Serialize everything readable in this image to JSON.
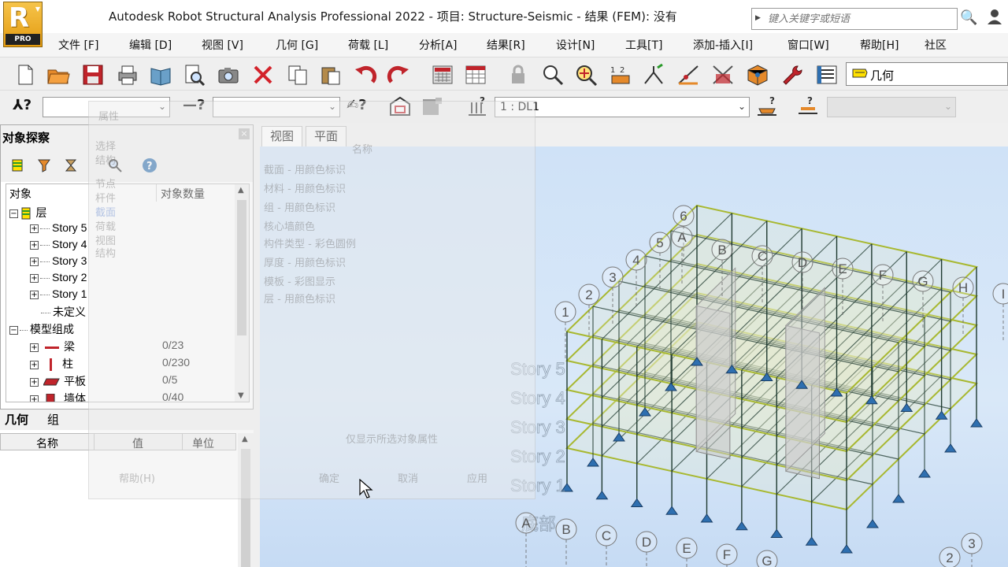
{
  "app": {
    "logo_letter": "R",
    "logo_badge": "PRO",
    "title": "Autodesk Robot Structural Analysis Professional 2022 - 项目: Structure-Seismic -  结果 (FEM): 没有",
    "search_placeholder": "键入关键字或短语"
  },
  "menu": [
    "文件 [F]",
    "编辑 [D]",
    "视图 [V]",
    "几何 [G]",
    "荷载 [L]",
    "分析[A]",
    "结果[R]",
    "设计[N]",
    "工具[T]",
    "添加-插入[I]",
    "窗口[W]",
    "帮助[H]",
    "社区"
  ],
  "toolbar": {
    "geometry_layout": "几何",
    "load_case": "1 : DL1"
  },
  "object_inspector": {
    "title": "对象探察",
    "col_object": "对象",
    "col_count": "对象数量",
    "rows": [
      {
        "label": "层",
        "count": ""
      },
      {
        "label": "Story 5",
        "count": ""
      },
      {
        "label": "Story 4",
        "count": ""
      },
      {
        "label": "Story 3",
        "count": ""
      },
      {
        "label": "Story 2",
        "count": ""
      },
      {
        "label": "Story 1",
        "count": ""
      },
      {
        "label": "未定义",
        "count": ""
      },
      {
        "label": "模型组成",
        "count": ""
      },
      {
        "label": "梁",
        "count": "0/23"
      },
      {
        "label": "柱",
        "count": "0/230"
      },
      {
        "label": "平板",
        "count": "0/5"
      },
      {
        "label": "墙体",
        "count": "0/40"
      }
    ],
    "tabs": [
      "几何",
      "组"
    ],
    "prop_cols": [
      "名称",
      "值",
      "单位"
    ]
  },
  "view_tabs": [
    "视图",
    "平面"
  ],
  "viewport": {
    "story_labels": [
      "Story 5",
      "Story 4",
      "Story 3",
      "Story 2",
      "Story 1",
      "底部"
    ],
    "grid_numbers": [
      "1",
      "2",
      "3",
      "4",
      "5",
      "6"
    ],
    "grid_letters_top": [
      "A",
      "B",
      "C",
      "D",
      "E",
      "F",
      "G",
      "H",
      "I"
    ],
    "grid_letters_bottom": [
      "A",
      "B",
      "C",
      "D",
      "E",
      "F",
      "G"
    ],
    "grid_numbers_bottom": [
      "2",
      "3"
    ]
  },
  "ghost_dialog": {
    "header": "名称",
    "left_items": [
      "属性",
      "选择",
      "结构",
      "节点",
      "杆件",
      "截面",
      "荷载",
      "视图",
      "结构"
    ],
    "rows": [
      "截面 - 用颜色标识",
      "材料 - 用颜色标识",
      "组 - 用颜色标识",
      "核心墙颜色",
      "构件类型 - 彩色圆例",
      "厚度 - 用颜色标识",
      "模板 - 彩图显示",
      "层 - 用颜色标识"
    ],
    "checkbox_label": "仅显示所选对象属性",
    "buttons": [
      "确定",
      "取消",
      "应用"
    ],
    "help": "帮助(H)"
  },
  "colors": {
    "viewport_bg": "#d4e5f7",
    "slab_outline": "#a8b830",
    "frame": "#1f3a30",
    "support": "#2e6fb0"
  }
}
